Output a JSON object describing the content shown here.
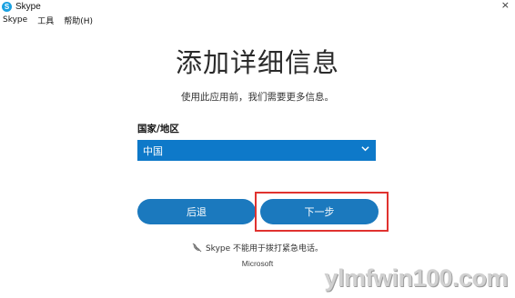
{
  "window": {
    "title": "Skype",
    "close_glyph": "×"
  },
  "menu": {
    "items": [
      "Skype",
      "工具",
      "帮助(H)"
    ]
  },
  "main": {
    "title": "添加详细信息",
    "subtitle": "使用此应用前，我们需要更多信息。",
    "country_label": "国家/地区",
    "country_value": "中国",
    "back_label": "后退",
    "next_label": "下一步",
    "notice": "Skype 不能用于拨打紧急电话。",
    "brand": "Microsoft"
  },
  "watermark": "ylmfwin100.com",
  "colors": {
    "accent": "#1b79be",
    "select_bg": "#0e79c9",
    "highlight": "#e0322f"
  },
  "icons": {
    "app": "skype-logo-icon",
    "dropdown": "chevron-down-icon",
    "notice": "no-phone-icon"
  }
}
